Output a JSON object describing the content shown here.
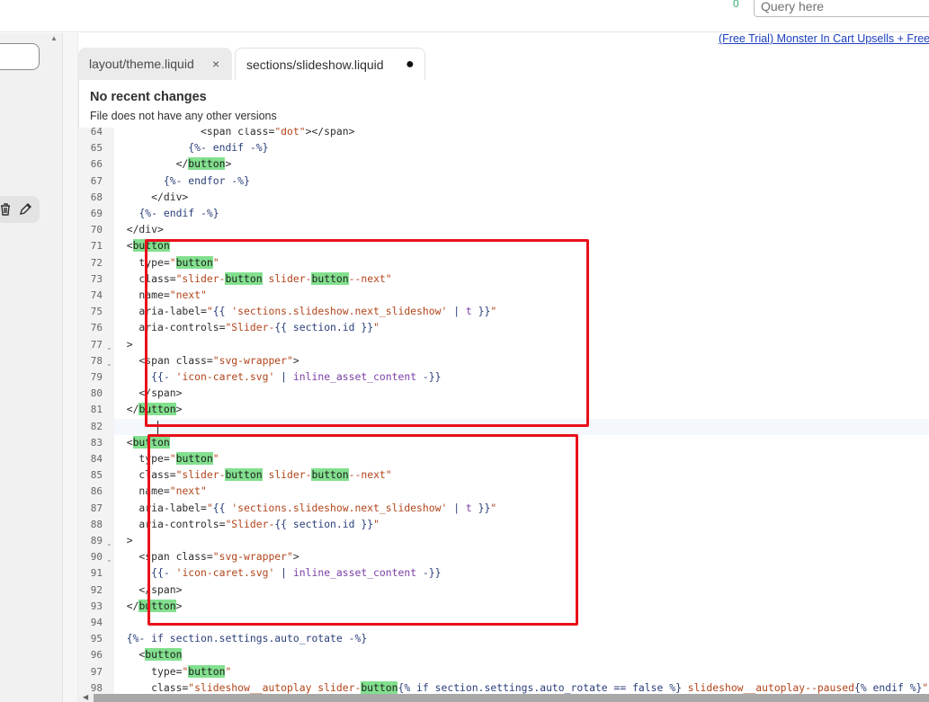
{
  "header": {
    "count": "0",
    "query_placeholder": "Query here"
  },
  "banner_link": "(Free Trial) Monster In Cart Upsells + Free",
  "tabs": [
    {
      "label_prefix": "layout/",
      "label_name": "theme.liquid",
      "close": "×"
    },
    {
      "label_prefix": "sections/",
      "label_name": "slideshow.liquid",
      "modified": "●"
    }
  ],
  "history": {
    "title": "No recent changes",
    "subtitle": "File does not have any other versions"
  },
  "editor": {
    "lines": [
      {
        "n": "64",
        "fold": false,
        "html": "              <span class=<s>\"dot\"</s>></span>"
      },
      {
        "n": "65",
        "fold": false,
        "html": "            <q>{%- endif -%}</q>"
      },
      {
        "n": "66",
        "fold": false,
        "html": "          </<m>button</m>>"
      },
      {
        "n": "67",
        "fold": false,
        "html": "        <q>{%- endfor -%}</q>"
      },
      {
        "n": "68",
        "fold": false,
        "html": "      </div>"
      },
      {
        "n": "69",
        "fold": false,
        "html": "    <q>{%- endif -%}</q>"
      },
      {
        "n": "70",
        "fold": false,
        "html": "  </div>"
      },
      {
        "n": "71",
        "fold": false,
        "html": "  <<m>button</m>"
      },
      {
        "n": "72",
        "fold": false,
        "html": "    type=<s>\"</s><m>button</m><s>\"</s>"
      },
      {
        "n": "73",
        "fold": false,
        "html": "    class=<s>\"slider-</s><m>button</m><s> slider-</s><m>button</m><s>--next\"</s>"
      },
      {
        "n": "74",
        "fold": false,
        "html": "    name=<s>\"next\"</s>"
      },
      {
        "n": "75",
        "fold": false,
        "html": "    aria-label=<s>\"</s><q>{{ </q><s>'sections.slideshow.next_slideshow'</s><q> | </q><v>t</v><q> }}</q><s>\"</s>"
      },
      {
        "n": "76",
        "fold": false,
        "html": "    aria-controls=<s>\"Slider-</s><q>{{ section.id }}</q><s>\"</s>"
      },
      {
        "n": "77",
        "fold": true,
        "html": "  >"
      },
      {
        "n": "78",
        "fold": true,
        "html": "    <span class=<s>\"svg-wrapper\"</s>>"
      },
      {
        "n": "79",
        "fold": false,
        "html": "      <q>{{- </q><s>'icon-caret.svg'</s><q> | </q><v>inline_asset_content</v><q> -}}</q>"
      },
      {
        "n": "80",
        "fold": false,
        "html": "    </span>"
      },
      {
        "n": "81",
        "fold": false,
        "html": "  </<m>button</m>>"
      },
      {
        "n": "82",
        "fold": false,
        "html": ""
      },
      {
        "n": "83",
        "fold": false,
        "html": "  <<m>button</m>"
      },
      {
        "n": "84",
        "fold": false,
        "html": "    type=<s>\"</s><m>button</m><s>\"</s>"
      },
      {
        "n": "85",
        "fold": false,
        "html": "    class=<s>\"slider-</s><m>button</m><s> slider-</s><m>button</m><s>--next\"</s>"
      },
      {
        "n": "86",
        "fold": false,
        "html": "    name=<s>\"next\"</s>"
      },
      {
        "n": "87",
        "fold": false,
        "html": "    aria-label=<s>\"</s><q>{{ </q><s>'sections.slideshow.next_slideshow'</s><q> | </q><v>t</v><q> }}</q><s>\"</s>"
      },
      {
        "n": "88",
        "fold": false,
        "html": "    aria-controls=<s>\"Slider-</s><q>{{ section.id }}</q><s>\"</s>"
      },
      {
        "n": "89",
        "fold": true,
        "html": "  >"
      },
      {
        "n": "90",
        "fold": true,
        "html": "    <span class=<s>\"svg-wrapper\"</s>>"
      },
      {
        "n": "91",
        "fold": false,
        "html": "      <q>{{- </q><s>'icon-caret.svg'</s><q> | </q><v>inline_asset_content</v><q> -}}</q>"
      },
      {
        "n": "92",
        "fold": false,
        "html": "    </span>"
      },
      {
        "n": "93",
        "fold": false,
        "html": "  </<m>button</m>>"
      },
      {
        "n": "94",
        "fold": false,
        "html": ""
      },
      {
        "n": "95",
        "fold": false,
        "html": "  <q>{%- if section.settings.auto_rotate -%}</q>"
      },
      {
        "n": "96",
        "fold": false,
        "html": "    <<m>button</m>"
      },
      {
        "n": "97",
        "fold": false,
        "html": "      type=<s>\"</s><m>button</m><s>\"</s>"
      },
      {
        "n": "98",
        "fold": false,
        "html": "      class=<s>\"slideshow__autoplay slider-</s><m>button</m><q>{% if section.settings.auto_rotate == false %}</q><s> slideshow__autoplay--paused</s><q>{% endif %}</q><s>\"</s>"
      }
    ]
  }
}
